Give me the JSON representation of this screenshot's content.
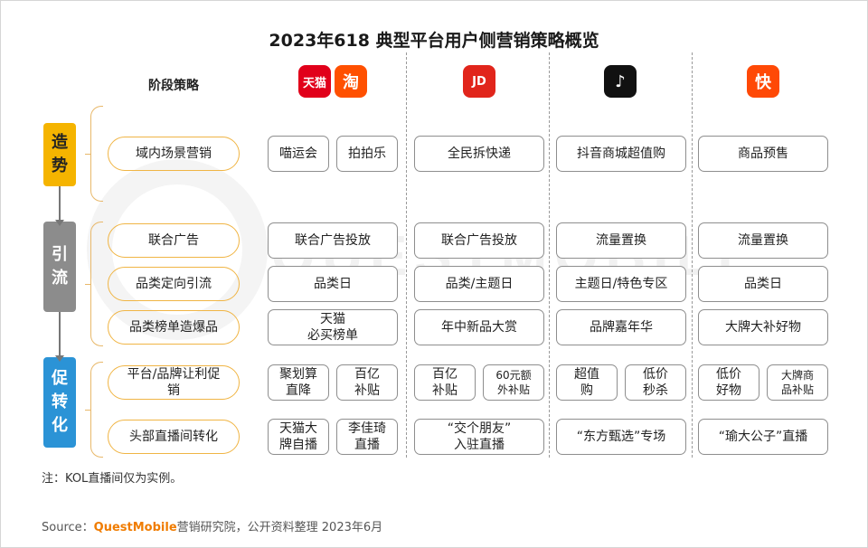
{
  "title": "2023年618 典型平台用户侧营销策略概览",
  "watermark": "QUESTMOBILE",
  "header_label": "阶段策略",
  "platforms": [
    {
      "name": "tmall",
      "logo_text": "天猫",
      "color": "#e1001a",
      "icon": "tmall-logo-icon"
    },
    {
      "name": "taobao",
      "logo_text": "淘",
      "color": "#ff5000",
      "icon": "taobao-logo-icon"
    },
    {
      "name": "jd",
      "logo_text": "JD",
      "color": "#e1251b",
      "icon": "jd-dog-logo-icon"
    },
    {
      "name": "douyin",
      "logo_text": "♪",
      "color": "#111111",
      "icon": "douyin-logo-icon"
    },
    {
      "name": "kuaishou",
      "logo_text": "快",
      "color": "#ff4906",
      "icon": "kuaishou-logo-icon"
    }
  ],
  "stages": [
    {
      "chars": [
        "造",
        "势"
      ],
      "color": "#f5b400"
    },
    {
      "chars": [
        "引",
        "流"
      ],
      "color": "#8c8c8c"
    },
    {
      "chars": [
        "促",
        "转",
        "化"
      ],
      "color": "#2b93d6"
    }
  ],
  "strategies": [
    "域内场景营销",
    "联合广告",
    "品类定向引流",
    "品类榜单造爆品",
    "平台/品牌让利促销",
    "头部直播间转化"
  ],
  "rows": [
    {
      "alibaba": [
        "喵运会",
        "拍拍乐"
      ],
      "jd": [
        "全民拆快递"
      ],
      "douyin": [
        "抖音商城超值购"
      ],
      "kuaishou": [
        "商品预售"
      ]
    },
    {
      "alibaba": [
        "联合广告投放"
      ],
      "jd": [
        "联合广告投放"
      ],
      "douyin": [
        "流量置换"
      ],
      "kuaishou": [
        "流量置换"
      ]
    },
    {
      "alibaba": [
        "品类日"
      ],
      "jd": [
        "品类/主题日"
      ],
      "douyin": [
        "主题日/特色专区"
      ],
      "kuaishou": [
        "品类日"
      ]
    },
    {
      "alibaba": [
        "天猫\n必买榜单"
      ],
      "jd": [
        "年中新品大赏"
      ],
      "douyin": [
        "品牌嘉年华"
      ],
      "kuaishou": [
        "大牌大补好物"
      ]
    },
    {
      "alibaba": [
        "聚划算\n直降",
        "百亿\n补贴"
      ],
      "jd": [
        "百亿\n补贴",
        "60元额\n外补贴"
      ],
      "douyin": [
        "超值\n购",
        "低价\n秒杀"
      ],
      "kuaishou": [
        "低价\n好物",
        "大牌商\n品补贴"
      ]
    },
    {
      "alibaba": [
        "天猫大\n牌自播",
        "李佳琦\n直播"
      ],
      "jd": [
        "“交个朋友”\n入驻直播"
      ],
      "douyin": [
        "“东方甄选”专场"
      ],
      "kuaishou": [
        "“瑜大公子”直播"
      ]
    }
  ],
  "note": "注：KOL直播间仅为实例。",
  "source": {
    "prefix": "Source：",
    "brand": "QuestMobile",
    "suffix": "营销研究院，公开资料整理 2023年6月"
  }
}
